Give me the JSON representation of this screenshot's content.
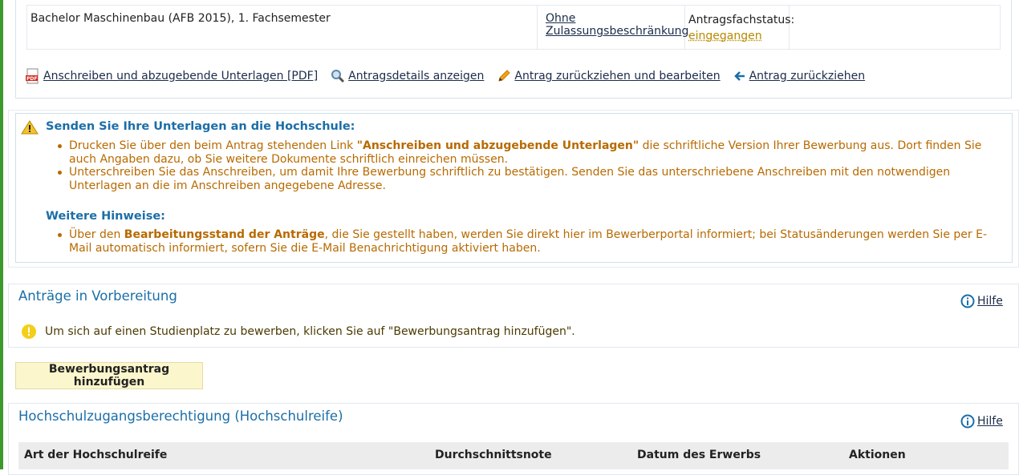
{
  "application": {
    "program": "Bachelor Maschinenbau (AFB 2015), 1. Fachsemester",
    "restriction_line1": "Ohne",
    "restriction_line2": "Zulassungsbeschränkung",
    "status_label": "Antragsfachstatus:",
    "status_value": "eingegangen"
  },
  "actions": {
    "pdf_label": "Anschreiben und abzugebende Unterlagen [PDF]",
    "details_label": "Antragsdetails anzeigen",
    "withdraw_edit_label": "Antrag zurückziehen und bearbeiten",
    "withdraw_label": "Antrag zurückziehen"
  },
  "notice": {
    "title": "Senden Sie Ihre Unterlagen an die Hochschule:",
    "item1_pre": "Drucken Sie über den beim Antrag stehenden Link ",
    "item1_bold": "\"Anschreiben und abzugebende Unterlagen\"",
    "item1_post": " die schriftliche Version Ihrer Bewerbung aus. Dort finden Sie auch Angaben dazu, ob Sie weitere Dokumente schriftlich einreichen müssen.",
    "item2": "Unterschreiben Sie das Anschreiben, um damit Ihre Bewerbung schriftlich zu bestätigen. Senden Sie das unterschriebene Anschreiben mit den notwendigen Unterlagen an die im Anschreiben angegebene Adresse.",
    "hints_title": "Weitere Hinweise:",
    "hint_pre": "Über den ",
    "hint_bold": "Bearbeitungsstand der Anträge",
    "hint_post": ", die Sie gestellt haben, werden Sie direkt hier im Bewerberportal informiert; bei Statusänderungen werden Sie per E-Mail automatisch informiert, sofern Sie die E-Mail Benachrichtigung aktiviert haben."
  },
  "prep": {
    "title": "Anträge in Vorbereitung",
    "help": "Hilfe",
    "info": "Um sich auf einen Studienplatz zu bewerben, klicken Sie auf \"Bewerbungsantrag hinzufügen\"."
  },
  "add_button": "Bewerbungsantrag hinzufügen",
  "hzb": {
    "title": "Hochschulzugangsberechtigung (Hochschulreife)",
    "help": "Hilfe",
    "columns": [
      "Art der Hochschulreife",
      "Durchschnittsnote",
      "Datum des Erwerbs",
      "Aktionen"
    ]
  },
  "colors": {
    "heading": "#1b6ea8",
    "warning_text": "#b86a00",
    "button_bg": "#fbf6cc",
    "status": "#b88a00"
  }
}
